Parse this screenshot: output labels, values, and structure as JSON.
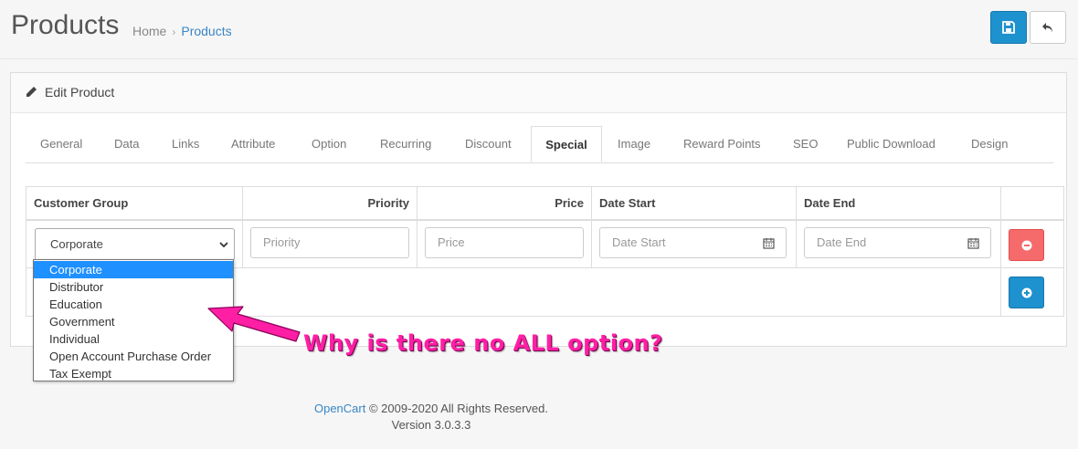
{
  "header": {
    "title": "Products",
    "breadcrumb": [
      "Home",
      "Products"
    ],
    "save_icon": "save-icon",
    "back_icon": "reply-icon"
  },
  "panel": {
    "title": "Edit Product",
    "icon": "pencil-icon"
  },
  "tabs": [
    {
      "label": "General"
    },
    {
      "label": "Data"
    },
    {
      "label": "Links"
    },
    {
      "label": "Attribute"
    },
    {
      "label": "Option"
    },
    {
      "label": "Recurring"
    },
    {
      "label": "Discount"
    },
    {
      "label": "Special",
      "active": true
    },
    {
      "label": "Image"
    },
    {
      "label": "Reward Points"
    },
    {
      "label": "SEO"
    },
    {
      "label": "Public Download"
    },
    {
      "label": "Design"
    }
  ],
  "table": {
    "columns": [
      "Customer Group",
      "Priority",
      "Price",
      "Date Start",
      "Date End"
    ],
    "row": {
      "customer_group": "Corporate",
      "priority_placeholder": "Priority",
      "price_placeholder": "Price",
      "date_start_placeholder": "Date Start",
      "date_end_placeholder": "Date End"
    }
  },
  "dropdown": {
    "options": [
      "Corporate",
      "Distributor",
      "Education",
      "Government",
      "Individual",
      "Open Account Purchase Order",
      "Tax Exempt"
    ],
    "selected": "Corporate"
  },
  "annotation": {
    "text": "Why is there no ALL option?",
    "color": "#ff1fa5"
  },
  "footer": {
    "link": "OpenCart",
    "copyright": "© 2009-2020 All Rights Reserved.",
    "version": "Version 3.0.3.3"
  },
  "colors": {
    "primary": "#1e91cf",
    "danger": "#f56b6b",
    "link": "#3a86c4"
  }
}
